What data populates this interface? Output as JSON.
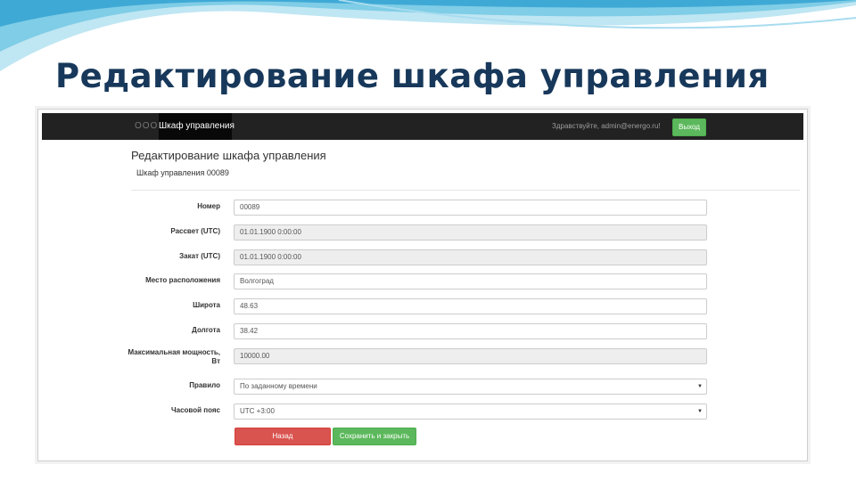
{
  "slide": {
    "title": "Редактирование шкафа управления"
  },
  "navbar": {
    "brand": "ООО",
    "active_item": "Шкаф управления",
    "greeting": "Здравствуйте, admin@energo.ru!",
    "logout_label": "Выход"
  },
  "form": {
    "heading": "Редактирование шкафа управления",
    "subheading": "Шкаф управления 00089",
    "fields": [
      {
        "label": "Номер",
        "value": "00089"
      },
      {
        "label": "Рассвет (UTC)",
        "value": "01.01.1900 0:00:00"
      },
      {
        "label": "Закат (UTC)",
        "value": "01.01.1900 0:00:00"
      },
      {
        "label": "Место расположения",
        "value": "Волгоград"
      },
      {
        "label": "Широта",
        "value": "48.63"
      },
      {
        "label": "Долгота",
        "value": "38.42"
      },
      {
        "label": "Максимальная мощность, Вт",
        "value": "10000.00"
      },
      {
        "label": "Правило",
        "value": "По заданному времени"
      },
      {
        "label": "Часовой пояс",
        "value": "UTC +3:00"
      }
    ],
    "back_label": "Назад",
    "save_label": "Сохранить и закрыть"
  },
  "colors": {
    "navbar": "#222222",
    "success": "#5cb85c",
    "danger": "#d9534f",
    "title": "#17385a"
  }
}
